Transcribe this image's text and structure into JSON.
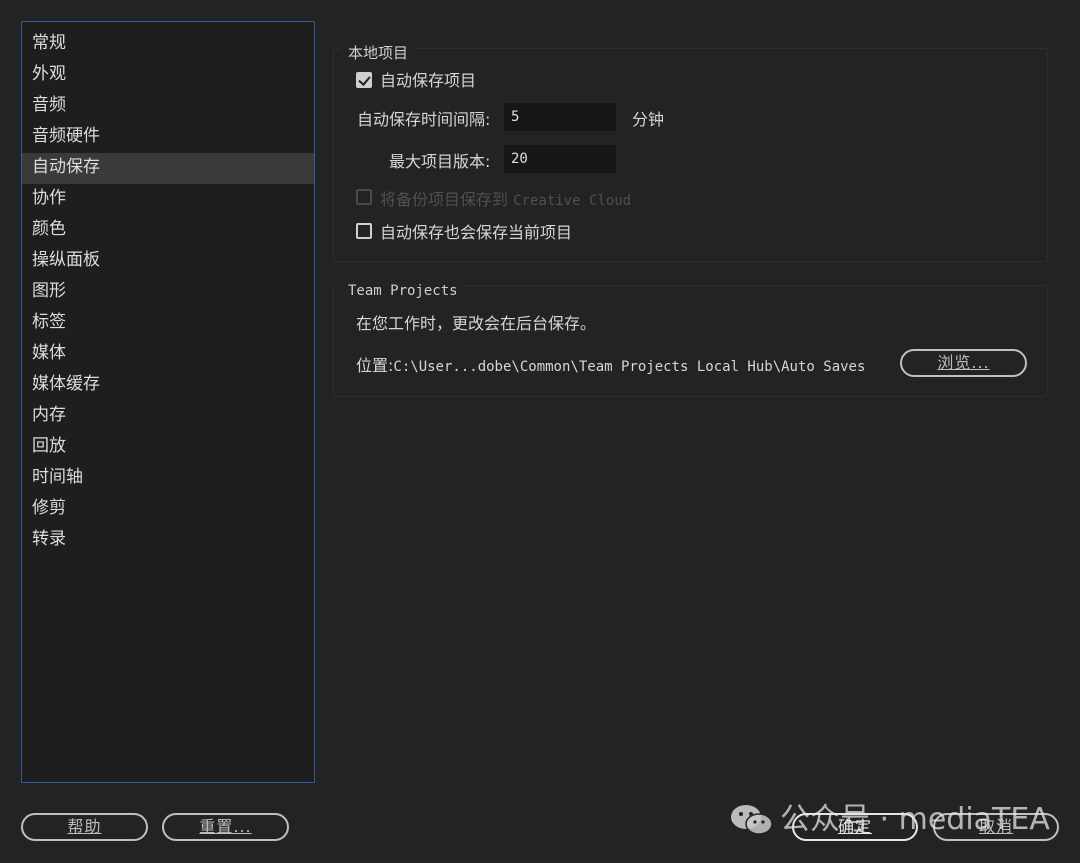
{
  "sidebar": {
    "items": [
      {
        "label": "常规"
      },
      {
        "label": "外观"
      },
      {
        "label": "音频"
      },
      {
        "label": "音频硬件"
      },
      {
        "label": "自动保存",
        "selected": true
      },
      {
        "label": "协作"
      },
      {
        "label": "颜色"
      },
      {
        "label": "操纵面板"
      },
      {
        "label": "图形"
      },
      {
        "label": "标签"
      },
      {
        "label": "媒体"
      },
      {
        "label": "媒体缓存"
      },
      {
        "label": "内存"
      },
      {
        "label": "回放"
      },
      {
        "label": "时间轴"
      },
      {
        "label": "修剪"
      },
      {
        "label": "转录"
      }
    ]
  },
  "local_project": {
    "title": "本地项目",
    "autosave_checkbox": {
      "label": "自动保存项目",
      "checked": true
    },
    "interval": {
      "label": "自动保存时间间隔:",
      "value": "5",
      "unit": "分钟"
    },
    "max_versions": {
      "label": "最大项目版本:",
      "value": "20"
    },
    "cloud_backup": {
      "label_cn": "将备份项目保存到",
      "label_en": "Creative Cloud",
      "checked": false,
      "enabled": false
    },
    "save_current": {
      "label": "自动保存也会保存当前项目",
      "checked": false
    }
  },
  "team_projects": {
    "title": "Team Projects",
    "info": "在您工作时，更改会在后台保存。",
    "location_label": "位置:",
    "location_path": "C:\\User...dobe\\Common\\Team Projects Local Hub\\Auto Saves",
    "browse_label": "浏览..."
  },
  "buttons": {
    "help": "帮助",
    "reset": "重置...",
    "ok": "确定",
    "cancel": "取消"
  },
  "watermark": {
    "text": "公众号 · mediaTEA"
  },
  "colors": {
    "background": "#232323",
    "sidebar_border": "#2d5e9c",
    "selected_row": "#3a3a3a"
  }
}
